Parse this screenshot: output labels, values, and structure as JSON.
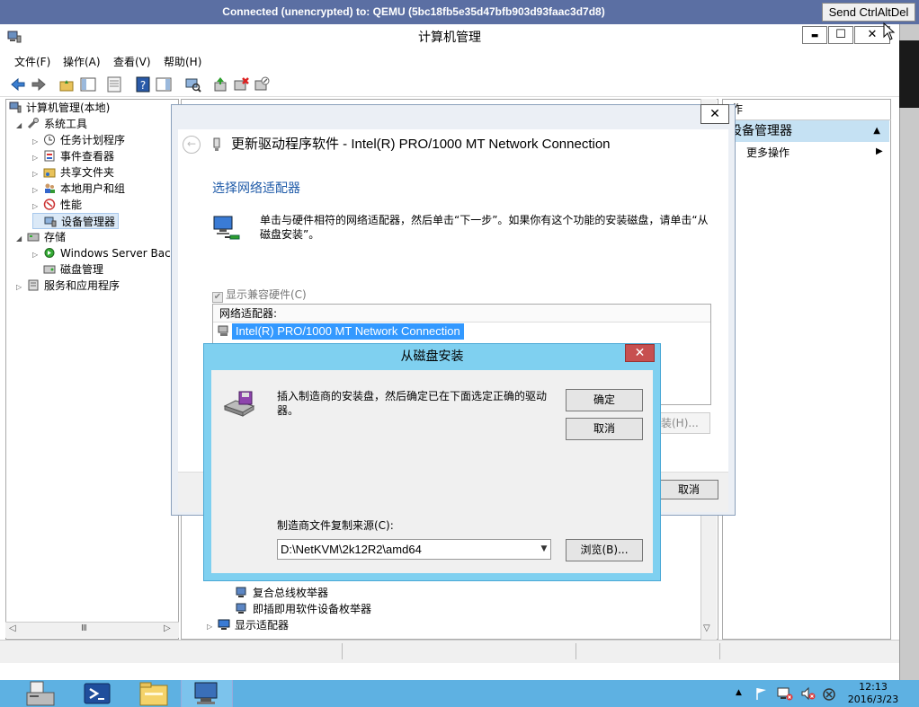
{
  "vnc": {
    "title": "Connected (unencrypted) to: QEMU (5bc18fb5e35d47bfb903d93faac3d7d8)",
    "send_cad": "Send CtrlAltDel"
  },
  "window": {
    "title": "计算机管理",
    "btn_min": "▬",
    "btn_max": "☐",
    "btn_close": "✕"
  },
  "menu": {
    "file": "文件(F)",
    "action": "操作(A)",
    "view": "查看(V)",
    "help": "帮助(H)"
  },
  "tree": {
    "root": "计算机管理(本地)",
    "system_tools": "系统工具",
    "task_scheduler": "任务计划程序",
    "event_viewer": "事件查看器",
    "shared_folders": "共享文件夹",
    "local_users": "本地用户和组",
    "performance": "性能",
    "device_manager": "设备管理器",
    "storage": "存储",
    "windows_server_backup": "Windows Server Bac",
    "disk_management": "磁盘管理",
    "services_apps": "服务和应用程序"
  },
  "devices": {
    "composite_bus": "复合总线枚举器",
    "pnp_enum": "即插即用软件设备枚举器",
    "display_adapters": "显示适配器"
  },
  "actions": {
    "header": "作",
    "selected": "设备管理器",
    "more": "更多操作"
  },
  "update_driver": {
    "close": "✕",
    "title": "更新驱动程序软件 - Intel(R) PRO/1000 MT Network Connection",
    "heading": "选择网络适配器",
    "description": "单击与硬件相符的网络适配器，然后单击“下一步”。如果你有这个功能的安装磁盘，请单击“从磁盘安装”。",
    "show_compatible": "显示兼容硬件(C)",
    "list_header": "网络适配器:",
    "list_item": "Intel(R) PRO/1000 MT Network Connection",
    "have_disk": "装(H)...",
    "cancel": "取消"
  },
  "from_disk": {
    "title": "从磁盘安装",
    "close": "✕",
    "message": "插入制造商的安装盘，然后确定已在下面选定正确的驱动器。",
    "ok": "确定",
    "cancel": "取消",
    "source_label": "制造商文件复制来源(C):",
    "source_value": "D:\\NetKVM\\2k12R2\\amd64",
    "browse": "浏览(B)..."
  },
  "taskbar": {
    "time": "12:13",
    "date": "2016/3/23"
  },
  "colors": {
    "vnc_bar": "#5b6fa3",
    "dialog_frame": "#7fd0f0",
    "selection": "#3399ff",
    "taskbar": "#5eb1e2",
    "heading_blue": "#1e5aa8"
  }
}
